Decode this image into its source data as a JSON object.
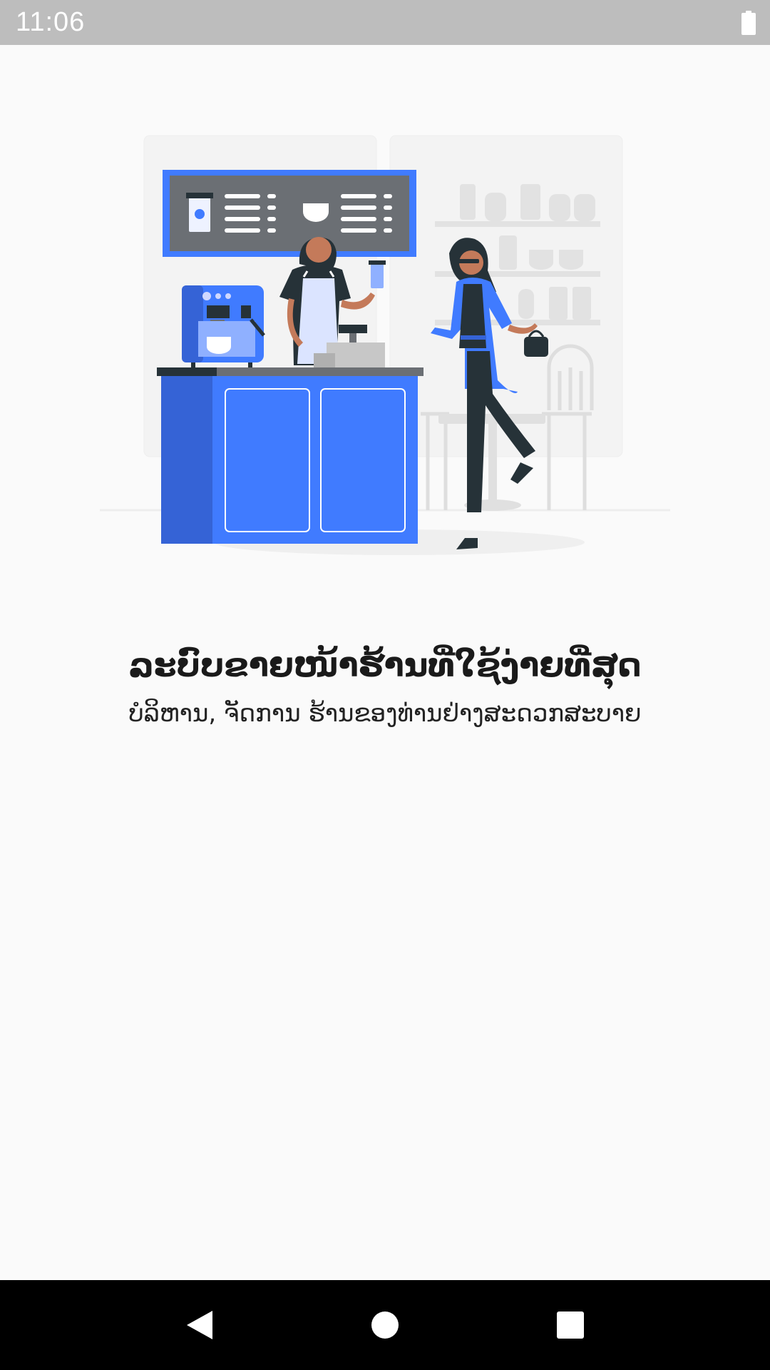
{
  "status_bar": {
    "time": "11:06",
    "battery_icon": "battery-full-icon"
  },
  "onboarding": {
    "illustration": "coffee-shop-illustration",
    "title": "ລະບົບຂາຍໜ້າຮ້ານທີ່ໃຊ້ງ່າຍທີ່ສຸດ",
    "subtitle": "ບໍລິຫານ, ຈັດການ ຮ້ານຂອງທ່ານຢ່າງສະດວກສະບາຍ"
  },
  "nav_bar": {
    "back_icon": "back-triangle-icon",
    "home_icon": "home-circle-icon",
    "recents_icon": "recents-square-icon"
  },
  "colors": {
    "status_bar": "#bdbdbd",
    "background": "#fafafa",
    "accent_blue": "#407bff",
    "dark_blue": "#3563d6",
    "nav_bar": "#000000"
  }
}
